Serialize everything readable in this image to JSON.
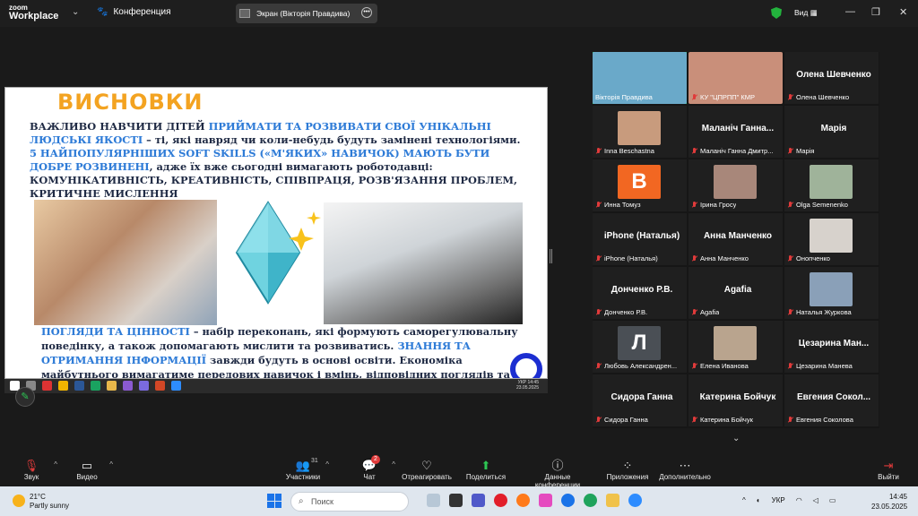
{
  "zoom": {
    "brand_top": "zoom",
    "brand_bottom": "Workplace",
    "meeting_label": "Конференция",
    "screen_label": "Экран (Вікторія Правдива)",
    "view_label": "Вид"
  },
  "slide": {
    "title": "ВИСНОВКИ",
    "p1_a": "ВАЖЛИВО НАВЧИТИ ДІТЕЙ ",
    "p1_hl": "ПРИЙМАТИ ТА РОЗВИВАТИ СВОЇ УНІКАЛЬНІ ЛЮДСЬКІ ЯКОСТІ",
    "p1_b": " – ті, які навряд чи коли-небудь будуть замінені технологіями.",
    "p2_hl": "5 НАЙПОПУЛЯРНІШИХ SOFT SKILLS («М'ЯКИХ» НАВИЧОК) МАЮТЬ БУТИ ДОБРЕ РОЗВИНЕНІ",
    "p2_b": ", адже їх вже сьогодні вимагають роботодавці: КОМУНІКАТИВНІСТЬ, КРЕАТИВНІСТЬ, СПІВПРАЦЯ, РОЗВ'ЯЗАННЯ ПРОБЛЕМ, КРИТИЧНЕ МИСЛЕННЯ",
    "p3_hl": "ПОГЛЯДИ ТА ЦІННОСТІ",
    "p3_b": " – набір переконань, які формують саморегулювальну поведінку, а також допомагають мислити та розвиватись. ",
    "p3_hl2": "ЗНАННЯ ТА ОТРИМАННЯ ІНФОРМАЦІЇ",
    "p3_c": " завжди будуть в основі освіти. Економіка майбутнього вимагатиме передових навичок і вмінь, відповідних поглядів та цінностей.",
    "inner_time": "14:45",
    "inner_date": "23.05.2025",
    "inner_lang": "УКР"
  },
  "participants": [
    {
      "tile": "",
      "label": "Вікторія Правдива",
      "muted": false,
      "avatar": "#6aa9c9"
    },
    {
      "tile": "",
      "label": "КУ \"ЦПРПП\" КМР",
      "muted": true,
      "avatar": "#c98f7a"
    },
    {
      "tile": "Олена Шевченко",
      "label": "Олена Шевченко",
      "muted": true,
      "avatar": ""
    },
    {
      "tile": "",
      "label": "Inna Beschastna",
      "muted": true,
      "avatar": "#c89b7d"
    },
    {
      "tile": "Маланіч Ганна...",
      "label": "Маланіч Ганна Дмитр...",
      "muted": true,
      "avatar": ""
    },
    {
      "tile": "Марія",
      "label": "Марія",
      "muted": true,
      "avatar": ""
    },
    {
      "tile": "",
      "label": "Инна Томуз",
      "muted": true,
      "avatar": "#f26722"
    },
    {
      "tile": "",
      "label": "Ірина Гросу",
      "muted": true,
      "avatar": "#a8877a"
    },
    {
      "tile": "",
      "label": "Olga Semenenko",
      "muted": true,
      "avatar": "#9fb39a"
    },
    {
      "tile": "iPhone (Наталья)",
      "label": "iPhone (Наталья)",
      "muted": true,
      "avatar": ""
    },
    {
      "tile": "Анна Манченко",
      "label": "Анна Манченко",
      "muted": true,
      "avatar": ""
    },
    {
      "tile": "",
      "label": "Онопченко",
      "muted": true,
      "avatar": "#d7d2cc"
    },
    {
      "tile": "Донченко Р.В.",
      "label": "Донченко Р.В.",
      "muted": true,
      "avatar": ""
    },
    {
      "tile": "Agafia",
      "label": "Agafia",
      "muted": true,
      "avatar": ""
    },
    {
      "tile": "",
      "label": "Наталья Журкова",
      "muted": true,
      "avatar": "#8aa0b8"
    },
    {
      "tile": "",
      "label": "Любовь Александрен...",
      "muted": true,
      "avatar": "#4a4f55"
    },
    {
      "tile": "",
      "label": "Елена Иванова",
      "muted": true,
      "avatar": "#b9a48e"
    },
    {
      "tile": "Цезарина Ман...",
      "label": "Цезарина Манева",
      "muted": true,
      "avatar": ""
    },
    {
      "tile": "Сидора Ганна",
      "label": "Сидора Ганна",
      "muted": true,
      "avatar": ""
    },
    {
      "tile": "Катерина Бойчук",
      "label": "Катерина Бойчук",
      "muted": true,
      "avatar": ""
    },
    {
      "tile": "Евгения Сокол...",
      "label": "Евгения Соколова",
      "muted": true,
      "avatar": ""
    }
  ],
  "avatar_letters": {
    "t6": "B",
    "t15": "Л"
  },
  "toolbar": {
    "audio": "Звук",
    "video": "Видео",
    "participants": "Участники",
    "participants_count": "31",
    "chat": "Чат",
    "chat_badge": "2",
    "react": "Отреагировать",
    "share": "Поделиться",
    "info": "Данные конференции",
    "apps": "Приложения",
    "more": "Дополнительно",
    "leave": "Выйти"
  },
  "taskbar": {
    "temp": "21°C",
    "weather": "Partly sunny",
    "search_placeholder": "Поиск",
    "lang": "УКР",
    "time": "14:45",
    "date": "23.05.2025"
  }
}
